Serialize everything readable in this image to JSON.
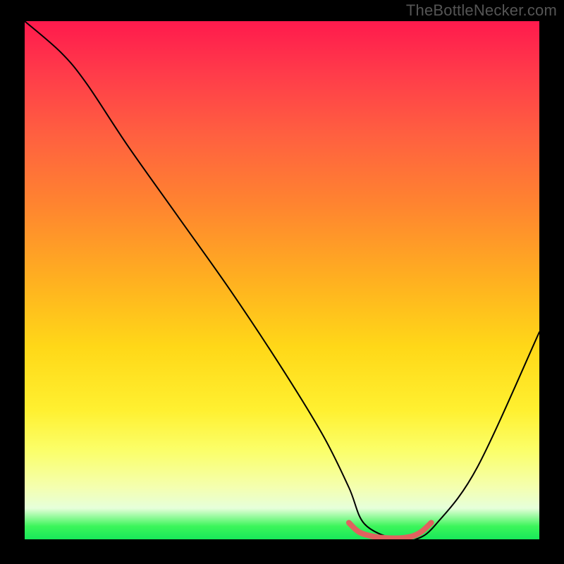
{
  "watermark": "TheBottleNecker.com",
  "chart_data": {
    "type": "line",
    "title": "",
    "xlabel": "",
    "ylabel": "",
    "xlim": [
      0,
      100
    ],
    "ylim": [
      0,
      100
    ],
    "series": [
      {
        "name": "bottleneck-curve",
        "x": [
          0,
          7,
          12,
          20,
          30,
          40,
          50,
          58,
          63,
          66,
          72,
          76,
          80,
          88,
          100
        ],
        "values": [
          100,
          94,
          88,
          76,
          62,
          48,
          33,
          20,
          10,
          3,
          0,
          0,
          3,
          14,
          40
        ]
      },
      {
        "name": "sweet-spot-marker",
        "x": [
          63,
          65,
          68,
          72,
          75,
          77,
          79
        ],
        "values": [
          3.2,
          1.4,
          0.5,
          0.2,
          0.5,
          1.4,
          3.2
        ]
      }
    ],
    "colors": {
      "curve": "#000000",
      "sweet_spot": "#e0625f"
    },
    "background_gradient": [
      "#ff1a4d",
      "#ff8330",
      "#ffd818",
      "#fbff6a",
      "#18e85a"
    ]
  }
}
